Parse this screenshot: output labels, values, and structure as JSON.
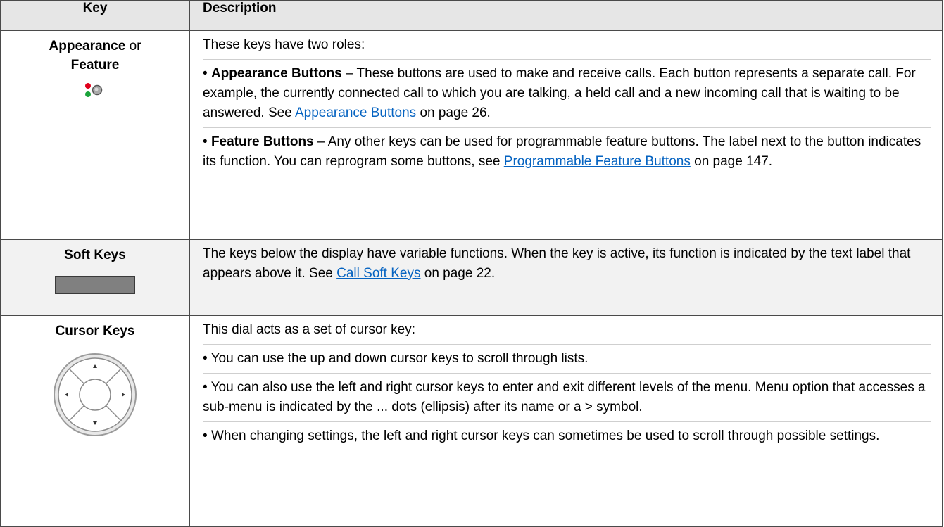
{
  "header": {
    "key": "Key",
    "description": "Description"
  },
  "rows": [
    {
      "key_main": "Appearance",
      "key_or": " or",
      "key_second": "Feature",
      "icon": "appearance-led-icon",
      "intro": "These keys have two roles:",
      "items": [
        {
          "bullet": "•",
          "term": "Appearance Buttons",
          "text": " – These buttons are used to make and receive calls. Each button represents a separate call. For example, the currently connected call to which you are talking, a held call and a new incoming call that is waiting to be answered. See ",
          "link": "Appearance Buttons",
          "after": " on page 26."
        },
        {
          "bullet": "•",
          "term": "Feature Buttons",
          "text": " – Any other keys can be used for programmable feature buttons. The label next to the button indicates its function. You can reprogram some buttons, see ",
          "link": "Programmable Feature Buttons",
          "after": " on page 147."
        }
      ]
    },
    {
      "key_main": "Soft Keys",
      "icon": "soft-key-icon",
      "text": "The keys below the display have variable functions. When the key is active, its function is indicated by the text label that appears above it. See ",
      "link": "Call Soft Keys",
      "after": " on page 22."
    },
    {
      "key_main": "Cursor Keys",
      "icon": "cursor-dial-icon",
      "intro": "This dial acts as a set of cursor key:",
      "items": [
        {
          "bullet": "•",
          "text": "You can use the up and down cursor keys to scroll through lists."
        },
        {
          "bullet": "•",
          "text": "You can also use the left and right cursor keys to enter and exit different levels of the menu. Menu option that accesses a sub-menu is indicated by the ... dots (ellipsis) after its name or a > symbol."
        },
        {
          "bullet": "•",
          "text": "When changing settings, the left and right cursor keys can sometimes be used to scroll through possible settings."
        }
      ]
    }
  ],
  "colors": {
    "header_bg": "#e6e6e6",
    "shade_bg": "#f2f2f2",
    "link": "#0563c1",
    "border": "#4a4a4a"
  }
}
